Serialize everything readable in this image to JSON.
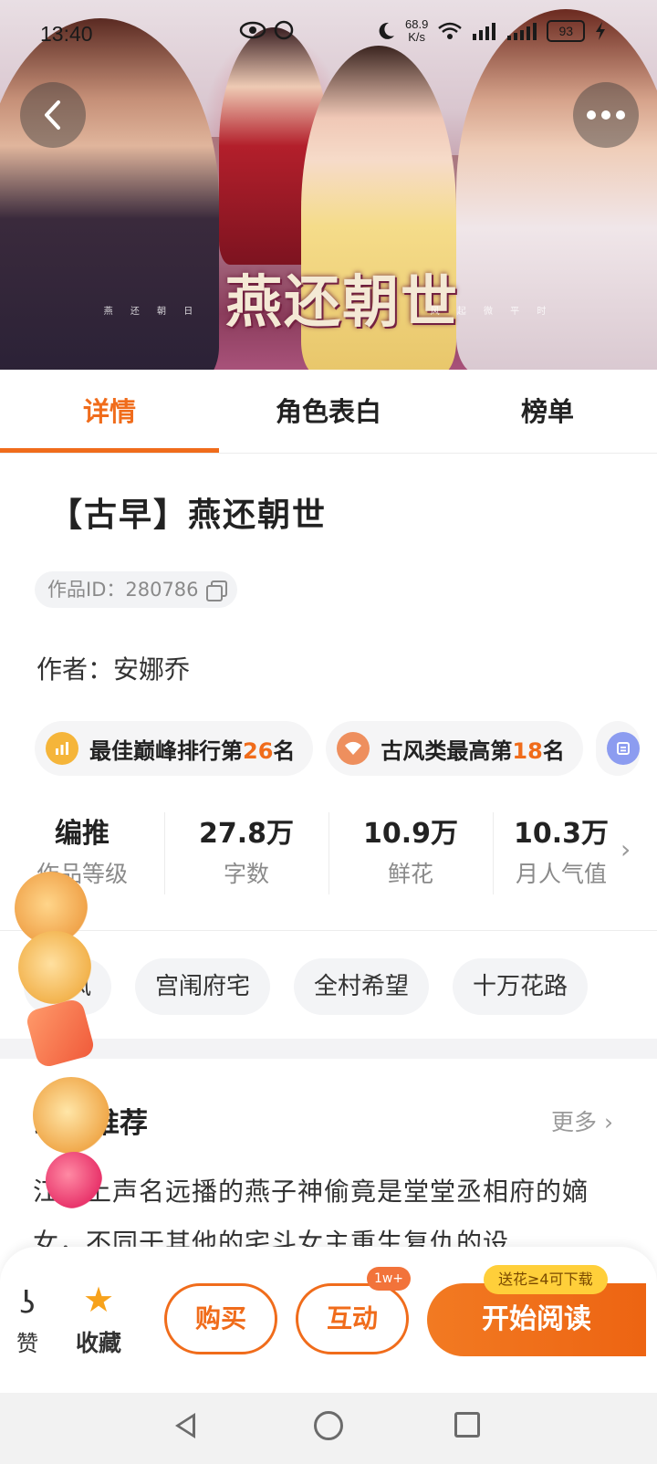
{
  "status_bar": {
    "time": "13:40",
    "net_speed_value": "68.9",
    "net_speed_unit": "K/s",
    "battery": "93"
  },
  "hero": {
    "title": "燕还朝世",
    "subtitle_chars": [
      "燕",
      "还",
      "朝",
      "日",
      "风",
      "起",
      "微",
      "平",
      "时"
    ]
  },
  "tabs": [
    {
      "label": "详情",
      "active": true
    },
    {
      "label": "角色表白",
      "active": false
    },
    {
      "label": "榜单",
      "active": false
    }
  ],
  "book": {
    "title": "【古早】燕还朝世",
    "work_id": "作品ID：280786",
    "author": "作者：安娜乔"
  },
  "rankings": [
    {
      "prefix": "最佳巅峰排行第",
      "num": "26",
      "suffix": "名",
      "icon_color": "#f5b53a"
    },
    {
      "prefix": "古风类最高第",
      "num": "18",
      "suffix": "名",
      "icon_color": "#ee8f5e"
    }
  ],
  "stats": [
    {
      "value": "编推",
      "label": "作品等级"
    },
    {
      "value": "27.8万",
      "label": "字数"
    },
    {
      "value": "10.9万",
      "label": "鲜花"
    },
    {
      "value": "10.3万",
      "label": "月人气值"
    }
  ],
  "tags": [
    "古风",
    "宫闱府宅",
    "全村希望",
    "十万花路"
  ],
  "recommend": {
    "title": "编辑推荐",
    "more": "更多",
    "text": "江湖上声名远播的燕子神偷竟是堂堂丞相府的嫡女，不同于其他的宅斗女主重生复仇的设"
  },
  "bottom_bar": {
    "like_label": "赞",
    "fav_label": "收藏",
    "buy_label": "购买",
    "interact_label": "互动",
    "interact_badge": "1w+",
    "read_label": "开始阅读",
    "gift_badge": "送花≥4可下载",
    "accent": "#f06c1b"
  }
}
